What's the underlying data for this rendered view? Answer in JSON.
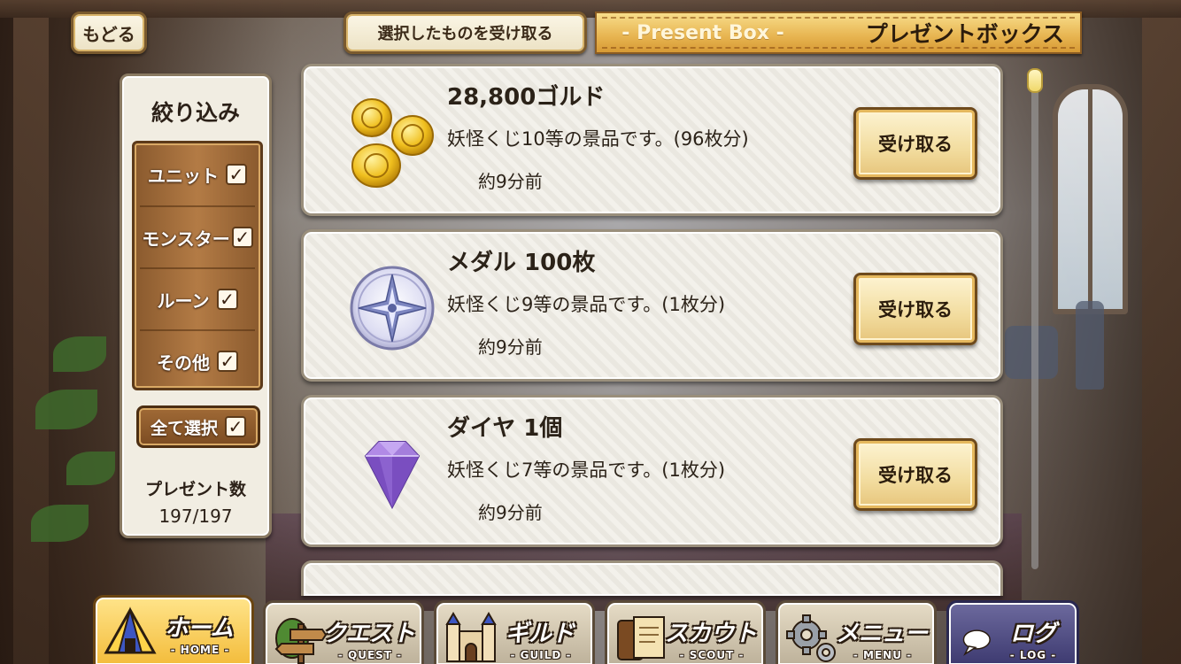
{
  "header": {
    "back_label": "もどる",
    "receive_selected_label": "選択したものを受け取る",
    "title_sub": "- Present Box -",
    "title_main": "プレゼントボックス"
  },
  "filter": {
    "title": "絞り込み",
    "options": [
      {
        "label": "ユニット",
        "checked": true
      },
      {
        "label": "モンスター",
        "checked": true
      },
      {
        "label": "ルーン",
        "checked": true
      },
      {
        "label": "その他",
        "checked": true
      }
    ],
    "check_mark": "✓",
    "select_all_label": "全て選択",
    "count_label": "プレゼント数",
    "count_value": "197/197"
  },
  "presents": [
    {
      "icon": "gold-coins-icon",
      "name": "28,800ゴルド",
      "description": "妖怪くじ10等の景品です。(96枚分)",
      "time": "約9分前",
      "button": "受け取る"
    },
    {
      "icon": "medal-icon",
      "name": "メダル 100枚",
      "description": "妖怪くじ9等の景品です。(1枚分)",
      "time": "約9分前",
      "button": "受け取る"
    },
    {
      "icon": "diamond-icon",
      "name": "ダイヤ 1個",
      "description": "妖怪くじ7等の景品です。(1枚分)",
      "time": "約9分前",
      "button": "受け取る"
    }
  ],
  "nav": [
    {
      "label": "ホーム",
      "sub": "- HOME -",
      "icon": "tent-icon",
      "active": true
    },
    {
      "label": "クエスト",
      "sub": "- QUEST -",
      "icon": "signpost-icon",
      "active": false
    },
    {
      "label": "ギルド",
      "sub": "- GUILD -",
      "icon": "castle-icon",
      "active": false
    },
    {
      "label": "スカウト",
      "sub": "- SCOUT -",
      "icon": "scroll-icon",
      "active": false
    },
    {
      "label": "メニュー",
      "sub": "- MENU -",
      "icon": "gear-icon",
      "active": false
    },
    {
      "label": "ログ",
      "sub": "- LOG -",
      "icon": "chat-bubble-icon",
      "active": false
    }
  ],
  "colors": {
    "banner_gold": "#e7b450",
    "panel_wood": "#b37b45",
    "card_bg": "#efece4"
  }
}
